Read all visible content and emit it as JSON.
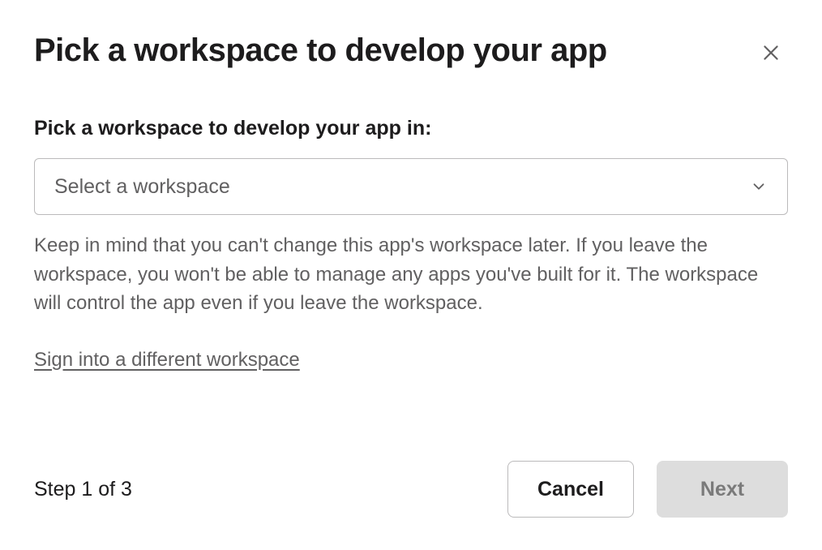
{
  "header": {
    "title": "Pick a workspace to develop your app"
  },
  "form": {
    "label": "Pick a workspace to develop your app in:",
    "select_placeholder": "Select a workspace",
    "help_text": "Keep in mind that you can't change this app's workspace later. If you leave the workspace, you won't be able to manage any apps you've built for it. The workspace will control the app even if you leave the workspace.",
    "signin_link": "Sign into a different workspace"
  },
  "footer": {
    "step_label": "Step 1 of 3",
    "cancel_label": "Cancel",
    "next_label": "Next"
  }
}
